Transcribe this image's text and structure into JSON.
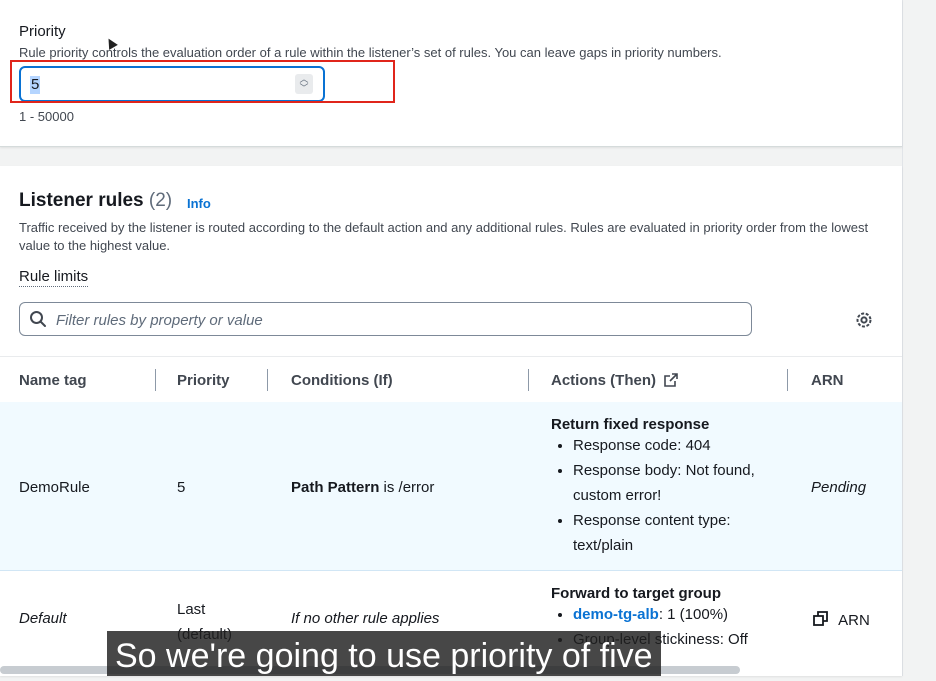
{
  "priority": {
    "label": "Priority",
    "description": "Rule priority controls the evaluation order of a rule within the listener’s set of rules. You can leave gaps in priority numbers.",
    "value": "5",
    "range_hint": "1 - 50000"
  },
  "listener_rules": {
    "title": "Listener rules",
    "count": "(2)",
    "info_label": "Info",
    "description": "Traffic received by the listener is routed according to the default action and any additional rules. Rules are evaluated in priority order from the lowest value to the highest value.",
    "rule_limits_label": "Rule limits",
    "filter_placeholder": "Filter rules by property or value",
    "columns": [
      "Name tag",
      "Priority",
      "Conditions (If)",
      "Actions (Then)",
      "ARN"
    ],
    "rows": [
      {
        "name": "DemoRule",
        "priority": "5",
        "condition_key": "Path Pattern",
        "condition_rest": " is /error",
        "action_title": "Return fixed response",
        "actions": [
          "Response code: 404",
          "Response body: Not found, custom error!",
          "Response content type: text/plain"
        ],
        "arn": "Pending"
      },
      {
        "name": "Default",
        "priority": "Last (default)",
        "condition": "If no other rule applies",
        "action_title": "Forward to target group",
        "target_link": "demo-tg-alb",
        "target_rest": ": 1 (100%)",
        "stickiness": "Group-level stickiness: Off",
        "arn": "ARN"
      }
    ]
  },
  "caption": "So we're going to use priority of five",
  "colors": {
    "accent": "#0972d3",
    "highlight_box": "#e0251b",
    "selected_row": "#f1faff"
  },
  "icons": [
    "search-icon",
    "gear-icon",
    "external-link-icon",
    "copy-icon",
    "stepper-icon"
  ]
}
